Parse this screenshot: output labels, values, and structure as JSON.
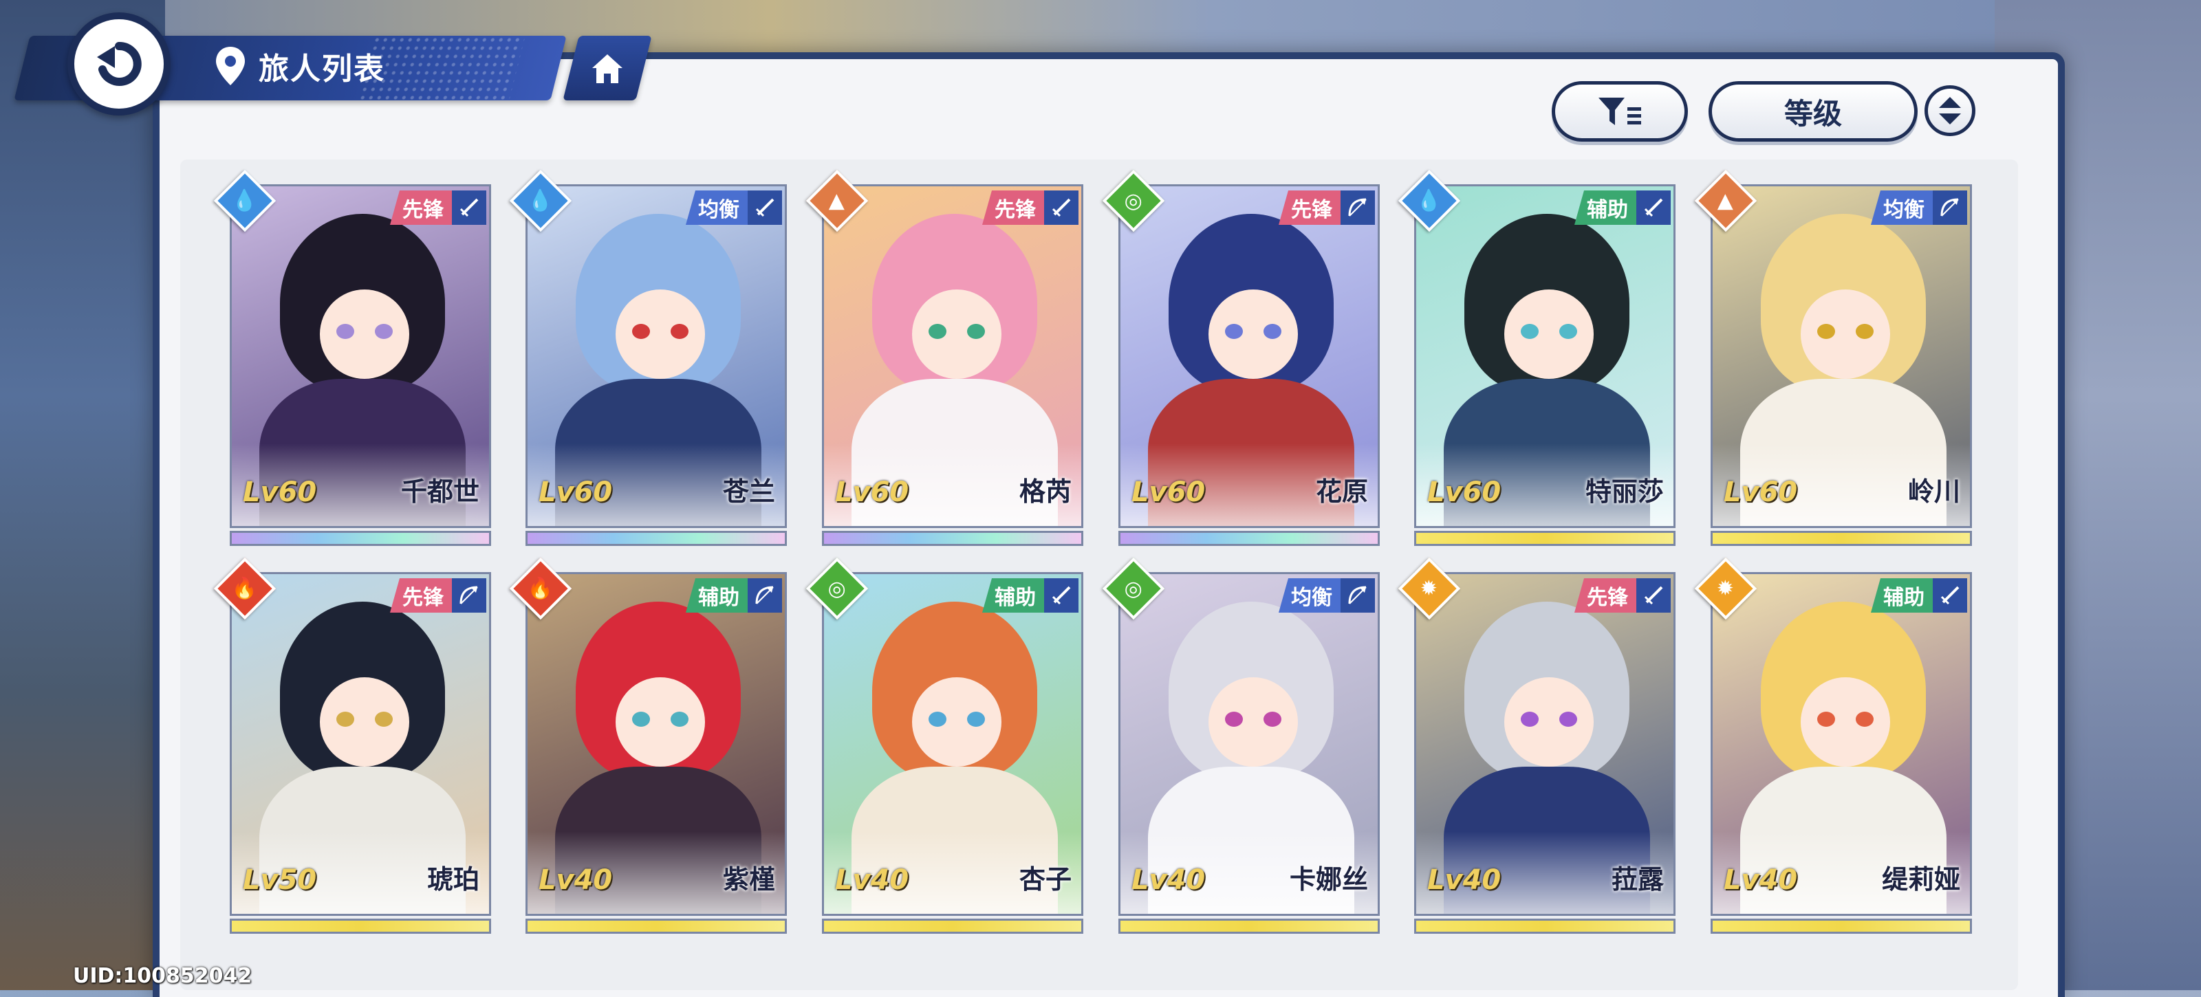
{
  "header": {
    "title": "旅人列表"
  },
  "toolbar": {
    "sort_label": "等级"
  },
  "footer": {
    "uid": "UID:100852042"
  },
  "colors": {
    "role_vanguard": "#e0607e",
    "role_balance": "#4a6fd0",
    "role_support": "#3aa870",
    "elem_water": "#3d8fe0",
    "elem_earth": "#e07b45",
    "elem_wind": "#4cae3a",
    "elem_fire": "#e0442e",
    "elem_light": "#f0a126",
    "rarity_gold": "#f3e25a",
    "rarity_rainbow": "#b48cf0"
  },
  "cards": [
    {
      "name": "千都世",
      "level": "Lv60",
      "role": "先锋",
      "element": "water-icon",
      "weapon": "sword-icon",
      "rarity": "rainbow"
    },
    {
      "name": "苍兰",
      "level": "Lv60",
      "role": "均衡",
      "element": "water-icon",
      "weapon": "sword-icon",
      "rarity": "rainbow"
    },
    {
      "name": "格芮",
      "level": "Lv60",
      "role": "先锋",
      "element": "earth-icon",
      "weapon": "sword-icon",
      "rarity": "rainbow"
    },
    {
      "name": "花原",
      "level": "Lv60",
      "role": "先锋",
      "element": "wind-icon",
      "weapon": "bow-icon",
      "rarity": "rainbow"
    },
    {
      "name": "特丽莎",
      "level": "Lv60",
      "role": "辅助",
      "element": "water-icon",
      "weapon": "sword-icon",
      "rarity": "gold"
    },
    {
      "name": "岭川",
      "level": "Lv60",
      "role": "均衡",
      "element": "earth-icon",
      "weapon": "bow-icon",
      "rarity": "gold"
    },
    {
      "name": "琥珀",
      "level": "Lv50",
      "role": "先锋",
      "element": "fire-icon",
      "weapon": "bow-icon",
      "rarity": "gold"
    },
    {
      "name": "紫槿",
      "level": "Lv40",
      "role": "辅助",
      "element": "fire-icon",
      "weapon": "bow-icon",
      "rarity": "gold"
    },
    {
      "name": "杏子",
      "level": "Lv40",
      "role": "辅助",
      "element": "wind-icon",
      "weapon": "sword-icon",
      "rarity": "gold"
    },
    {
      "name": "卡娜丝",
      "level": "Lv40",
      "role": "均衡",
      "element": "wind-icon",
      "weapon": "bow-icon",
      "rarity": "gold"
    },
    {
      "name": "菈露",
      "level": "Lv40",
      "role": "先锋",
      "element": "light-icon",
      "weapon": "sword-icon",
      "rarity": "gold"
    },
    {
      "name": "缇莉娅",
      "level": "Lv40",
      "role": "辅助",
      "element": "light-icon",
      "weapon": "sword-icon",
      "rarity": "gold"
    }
  ]
}
